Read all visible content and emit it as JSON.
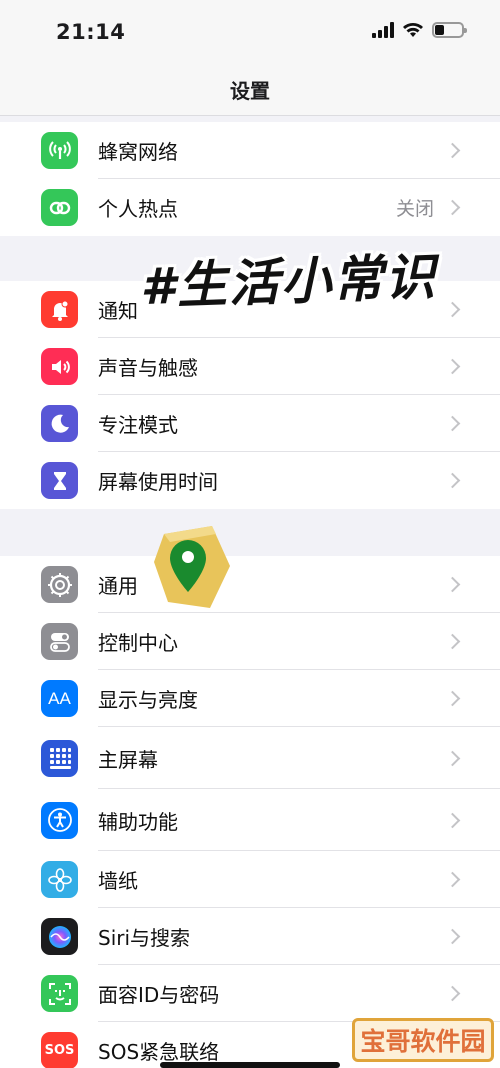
{
  "status": {
    "time": "21:14",
    "battery_level": 0.35
  },
  "nav": {
    "title": "设置"
  },
  "groups": [
    {
      "items": [
        {
          "label": "蜂窝网络",
          "icon": "antenna-icon",
          "color": "#34c759",
          "value": ""
        },
        {
          "label": "个人热点",
          "icon": "link-icon",
          "color": "#34c759",
          "value": "关闭"
        }
      ]
    },
    {
      "items": [
        {
          "label": "通知",
          "icon": "bell-icon",
          "color": "#ff3b30",
          "value": ""
        },
        {
          "label": "声音与触感",
          "icon": "speaker-icon",
          "color": "#ff2d55",
          "value": ""
        },
        {
          "label": "专注模式",
          "icon": "moon-icon",
          "color": "#5856d6",
          "value": ""
        },
        {
          "label": "屏幕使用时间",
          "icon": "hourglass-icon",
          "color": "#5856d6",
          "value": ""
        }
      ]
    },
    {
      "items": [
        {
          "label": "通用",
          "icon": "gear-icon",
          "color": "#8e8e93",
          "value": ""
        },
        {
          "label": "控制中心",
          "icon": "toggles-icon",
          "color": "#8e8e93",
          "value": ""
        },
        {
          "label": "显示与亮度",
          "icon": "text-size-icon",
          "color": "#007aff",
          "value": ""
        },
        {
          "label": "主屏幕",
          "icon": "app-grid-icon",
          "color": "#2c58d8",
          "value": ""
        },
        {
          "label": "辅助功能",
          "icon": "accessibility-icon",
          "color": "#007aff",
          "value": ""
        },
        {
          "label": "墙纸",
          "icon": "flower-icon",
          "color": "#32ade6",
          "value": ""
        },
        {
          "label": "Siri与搜索",
          "icon": "siri-icon",
          "color": "#1c1c1e",
          "value": ""
        },
        {
          "label": "面容ID与密码",
          "icon": "face-id-icon",
          "color": "#34c759",
          "value": ""
        },
        {
          "label": "SOS紧急联络",
          "icon": "sos-icon",
          "color": "#ff3b30",
          "value": "",
          "icon_text": "SOS"
        }
      ]
    }
  ],
  "overlays": {
    "tag_text": "#生活小常识",
    "brand_text": "宝哥软件园"
  }
}
